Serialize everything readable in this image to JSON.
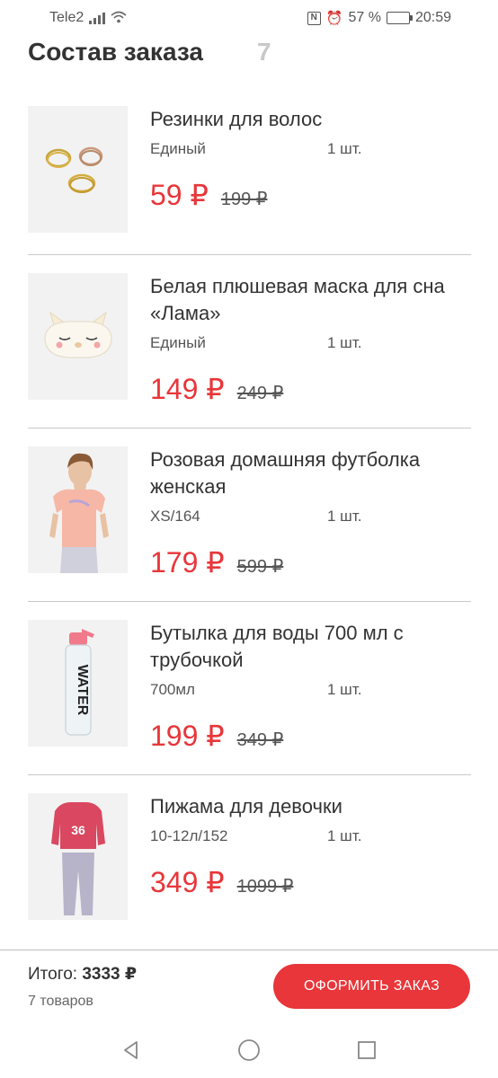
{
  "status_bar": {
    "carrier": "Tele2",
    "battery": "57 %",
    "battery_level": 0.57,
    "time": "20:59"
  },
  "header": {
    "title": "Состав заказа",
    "count": "7"
  },
  "items": [
    {
      "name": "Резинки для волос",
      "size": "Единый",
      "qty": "1 шт.",
      "price": "59 ₽",
      "old_price": "199 ₽",
      "image": "hair-ties-image"
    },
    {
      "name": "Белая плюшевая маска для сна «Лама»",
      "size": "Единый",
      "qty": "1 шт.",
      "price": "149 ₽",
      "old_price": "249 ₽",
      "image": "sleep-mask-image"
    },
    {
      "name": "Розовая домашняя футболка женская",
      "size": "XS/164",
      "qty": "1 шт.",
      "price": "179 ₽",
      "old_price": "599 ₽",
      "image": "tshirt-image"
    },
    {
      "name": "Бутылка для воды 700 мл с трубочкой",
      "size": "700мл",
      "qty": "1 шт.",
      "price": "199 ₽",
      "old_price": "349 ₽",
      "image": "water-bottle-image",
      "bottle_text": "WATER"
    },
    {
      "name": "Пижама для девочки",
      "size": "10-12л/152",
      "qty": "1 шт.",
      "price": "349 ₽",
      "old_price": "1099 ₽",
      "image": "pajama-image",
      "shirt_number": "36"
    }
  ],
  "footer": {
    "total_label": "Итого:",
    "total_value": "3333 ₽",
    "items_count": "7 товаров",
    "checkout_label": "ОФОРМИТЬ ЗАКАЗ"
  },
  "nav": {
    "back_icon": "back-triangle-icon",
    "home_icon": "home-circle-icon",
    "recents_icon": "recents-square-icon"
  }
}
